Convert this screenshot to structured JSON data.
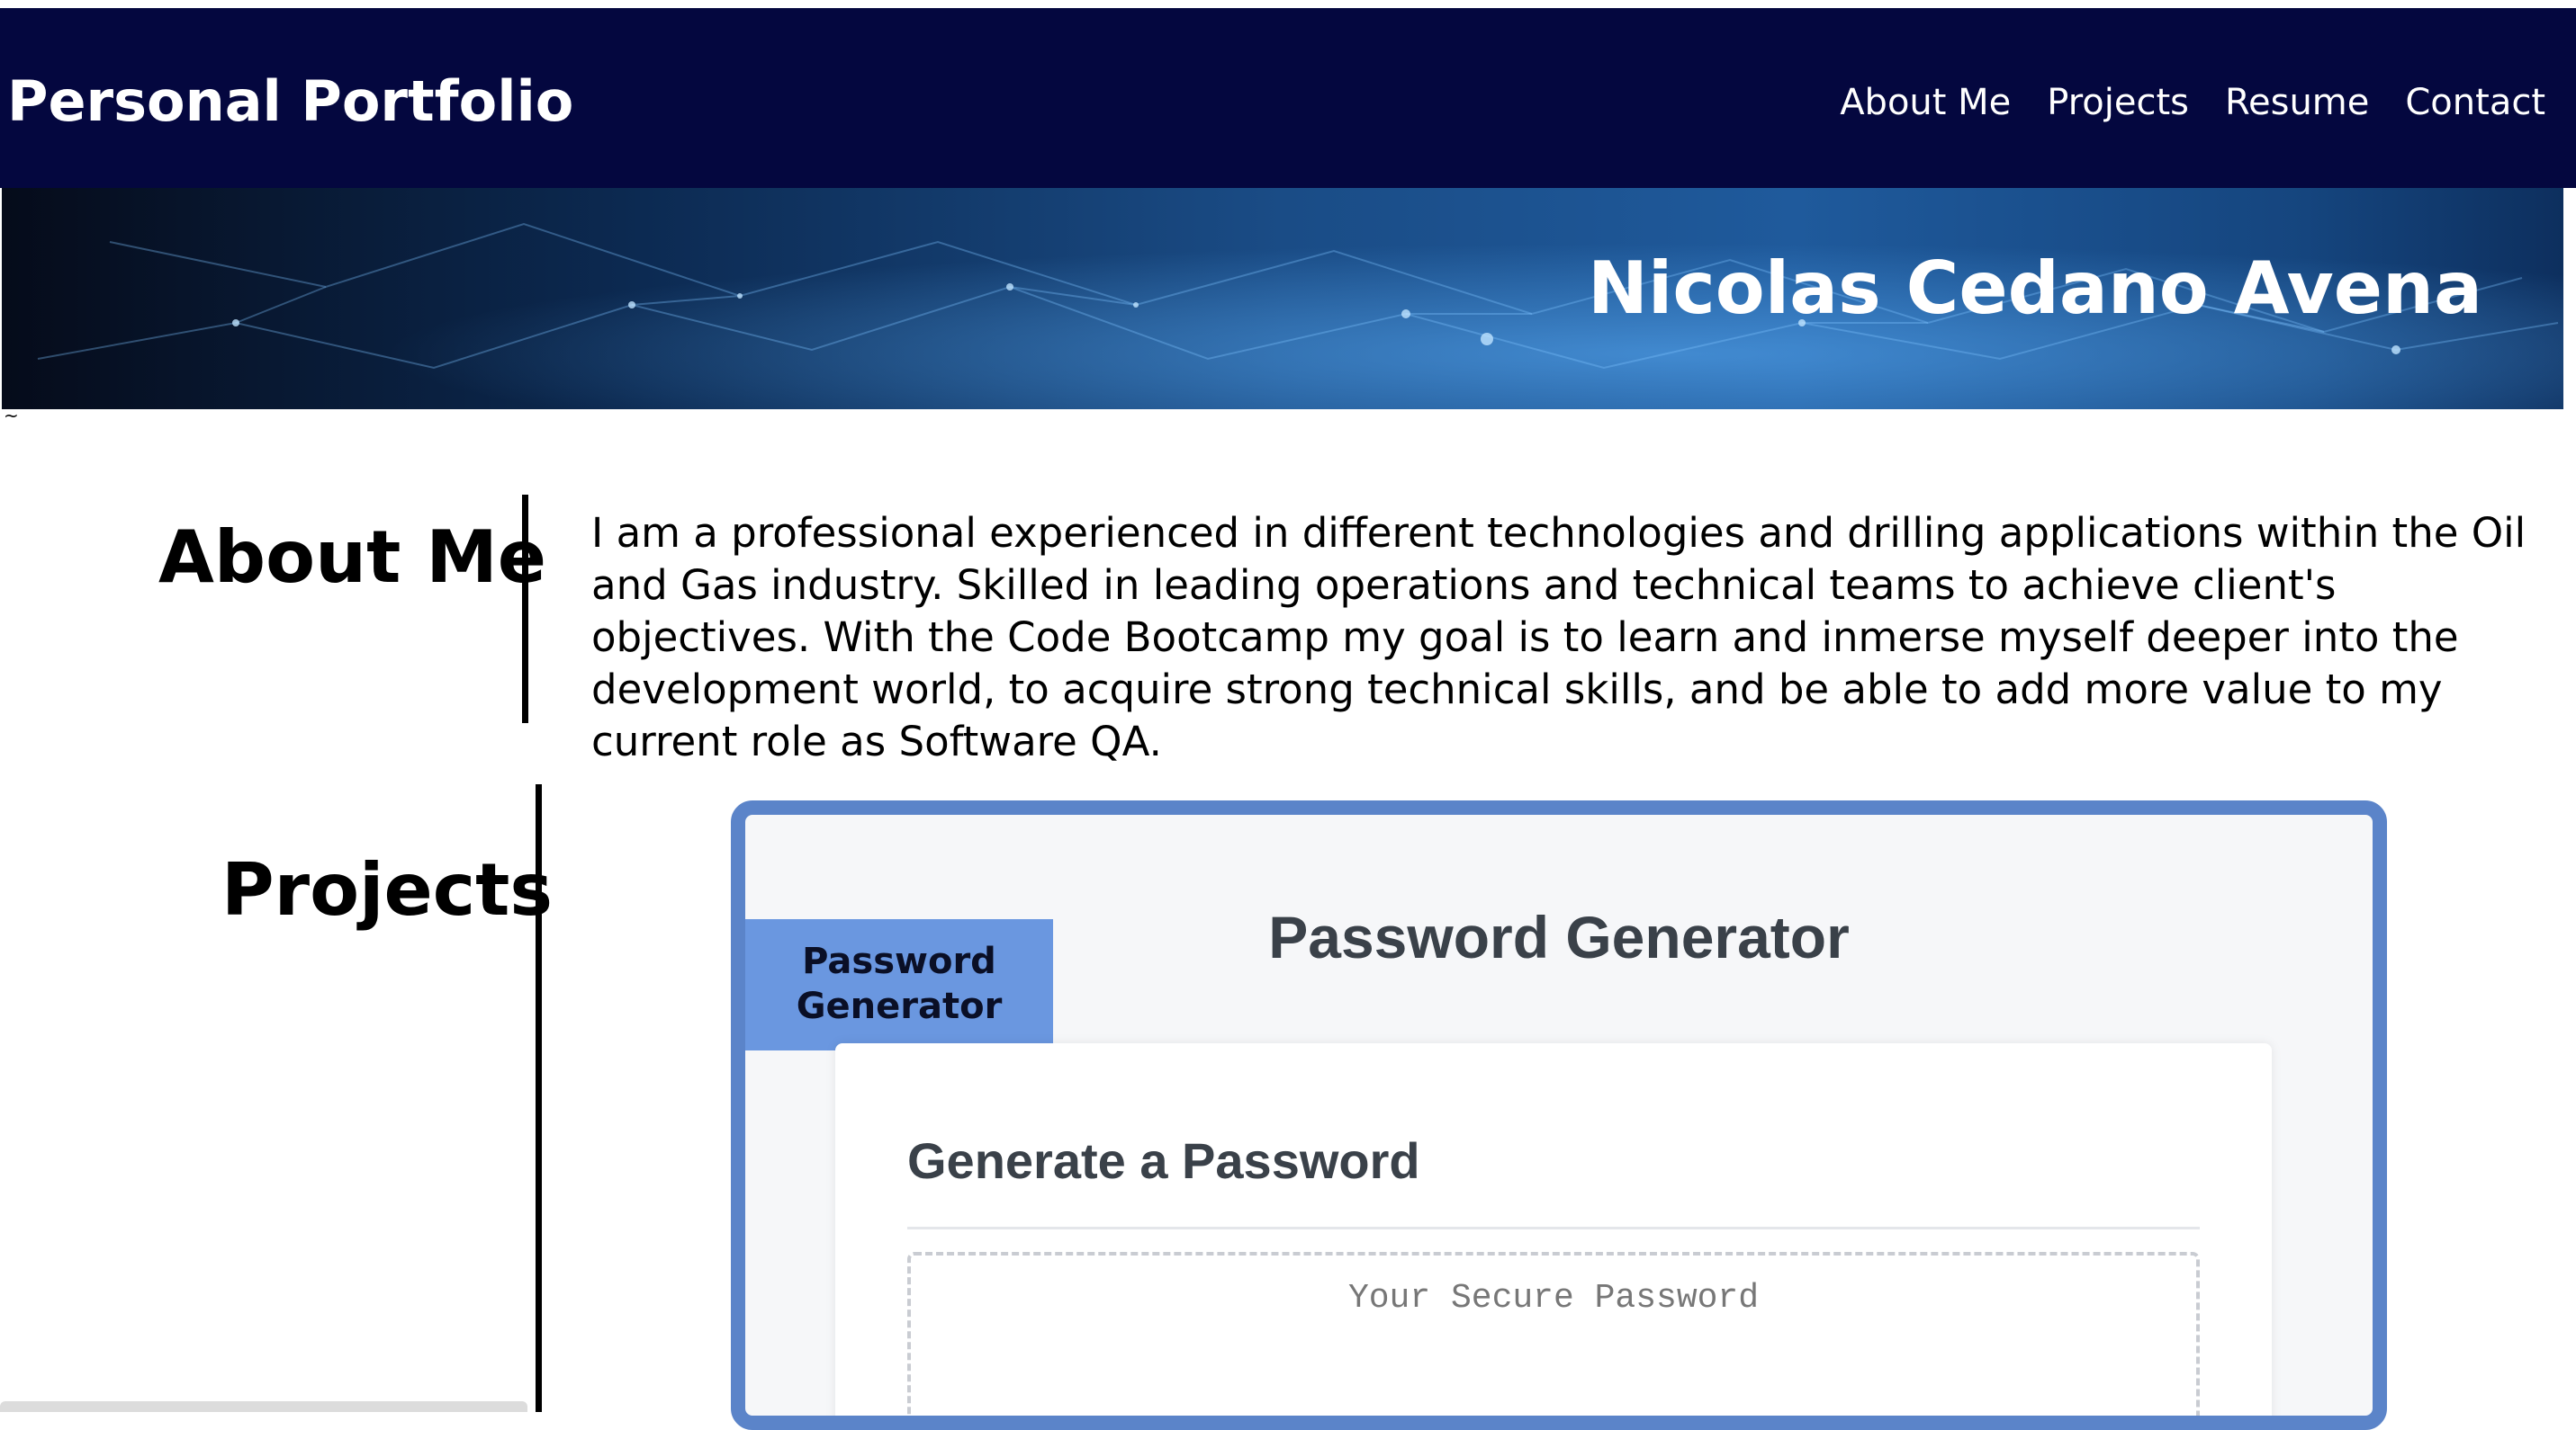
{
  "header": {
    "brand": "Personal Portfolio",
    "nav": [
      "About Me",
      "Projects",
      "Resume",
      "Contact"
    ]
  },
  "hero": {
    "name": "Nicolas Cedano Avena"
  },
  "stray_char": "~",
  "about": {
    "heading": "About Me",
    "text": "I am a professional experienced in different technologies and drilling applications within the Oil and Gas industry. Skilled in leading operations and technical teams to achieve client's objectives. With the Code Bootcamp my goal is to learn and inmerse myself deeper into the development world, to acquire strong technical skills, and be able to add more value to my current role as Software QA."
  },
  "projects": {
    "heading": "Projects",
    "card": {
      "tag_line1": "Password",
      "tag_line2": "Generator",
      "title": "Password Generator",
      "inner_title": "Generate a Password",
      "password_placeholder": "Your Secure Password"
    }
  },
  "colors": {
    "navbar": "#04073f",
    "card_border": "#5b84c9",
    "card_tag": "#6a97e0"
  }
}
